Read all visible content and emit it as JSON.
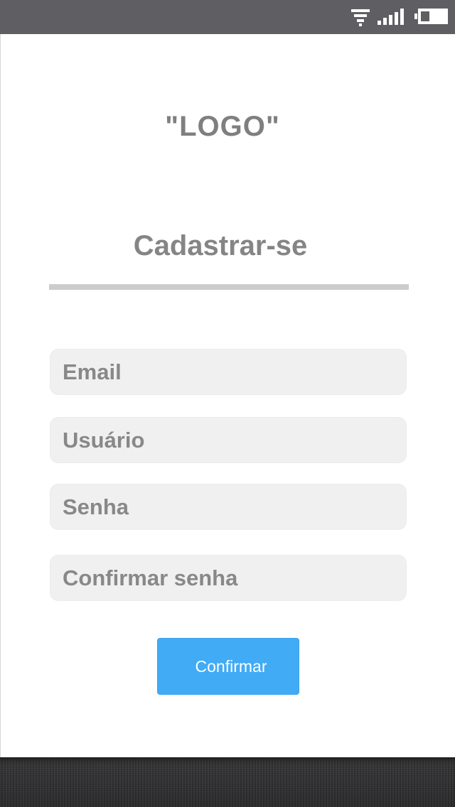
{
  "status_bar": {
    "icons": [
      "wifi-icon",
      "signal-icon",
      "battery-icon"
    ],
    "background": "#5f5e63"
  },
  "logo_text": "\"LOGO\"",
  "page_title": "Cadastrar-se",
  "form": {
    "email_placeholder": "Email",
    "username_placeholder": "Usuário",
    "password_placeholder": "Senha",
    "confirm_password_placeholder": "Confirmar senha",
    "submit_label": "Confirmar"
  },
  "colors": {
    "accent": "#41abf5",
    "text_gray": "#888888",
    "field_background": "#f0f0f0",
    "divider": "#cccccc"
  }
}
